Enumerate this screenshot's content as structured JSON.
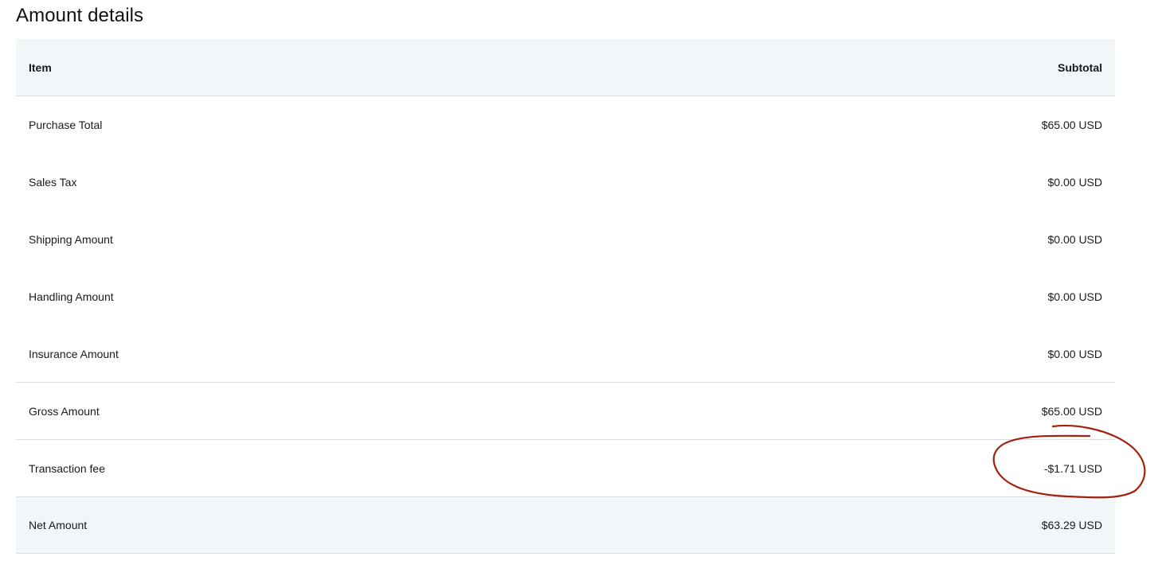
{
  "page": {
    "title": "Amount details"
  },
  "table": {
    "header": {
      "item": "Item",
      "subtotal": "Subtotal"
    },
    "rows": [
      {
        "label": "Purchase Total",
        "value": "$65.00 USD"
      },
      {
        "label": "Sales Tax",
        "value": "$0.00 USD"
      },
      {
        "label": "Shipping Amount",
        "value": "$0.00 USD"
      },
      {
        "label": "Handling Amount",
        "value": "$0.00 USD"
      },
      {
        "label": "Insurance Amount",
        "value": "$0.00 USD"
      },
      {
        "label": "Gross Amount",
        "value": "$65.00 USD"
      },
      {
        "label": "Transaction fee",
        "value": "-$1.71 USD"
      }
    ],
    "total": {
      "label": "Net Amount",
      "value": "$63.29 USD"
    }
  },
  "annotation": {
    "color": "#a3200e",
    "target": "Transaction fee value"
  },
  "colors": {
    "header_bg": "#f1f6f9",
    "divider": "#d9dcdf",
    "text": "#1a1a1a"
  }
}
